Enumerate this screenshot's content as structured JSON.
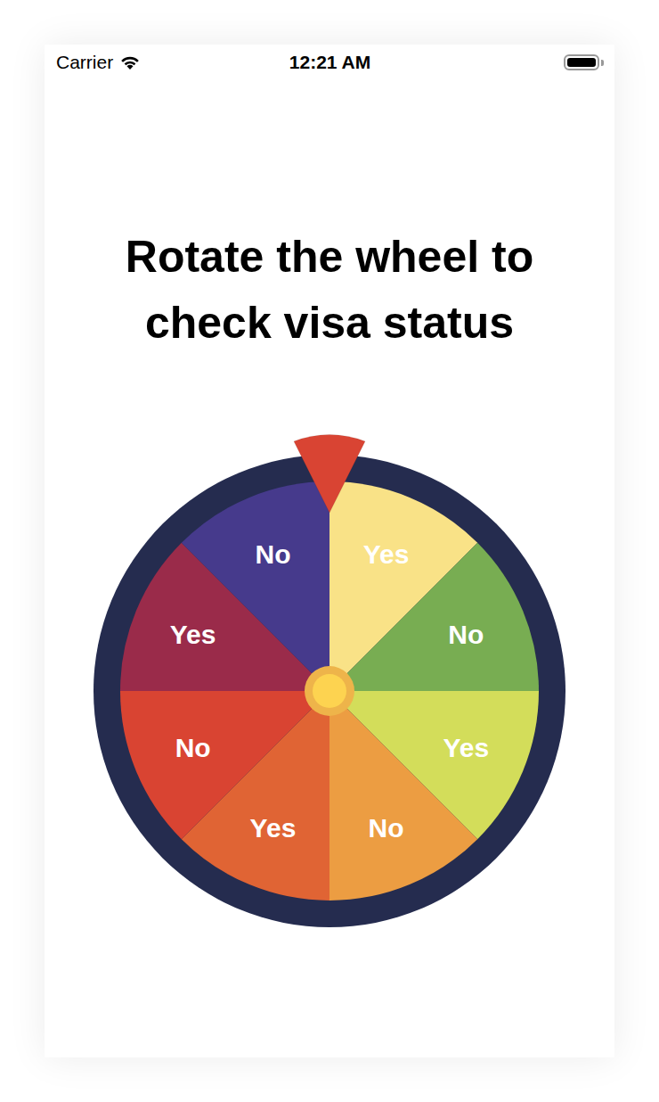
{
  "status_bar": {
    "carrier": "Carrier",
    "time": "12:21 AM",
    "battery": {
      "level": 1
    }
  },
  "title": "Rotate the wheel to check visa status",
  "wheel": {
    "segments": [
      {
        "label": "Yes",
        "color": "#f9e287"
      },
      {
        "label": "No",
        "color": "#78ad52"
      },
      {
        "label": "Yes",
        "color": "#d3dd5a"
      },
      {
        "label": "No",
        "color": "#ec9d42"
      },
      {
        "label": "Yes",
        "color": "#e06434"
      },
      {
        "label": "No",
        "color": "#d94432"
      },
      {
        "label": "Yes",
        "color": "#9a2b4a"
      },
      {
        "label": "No",
        "color": "#463a8c"
      }
    ]
  }
}
